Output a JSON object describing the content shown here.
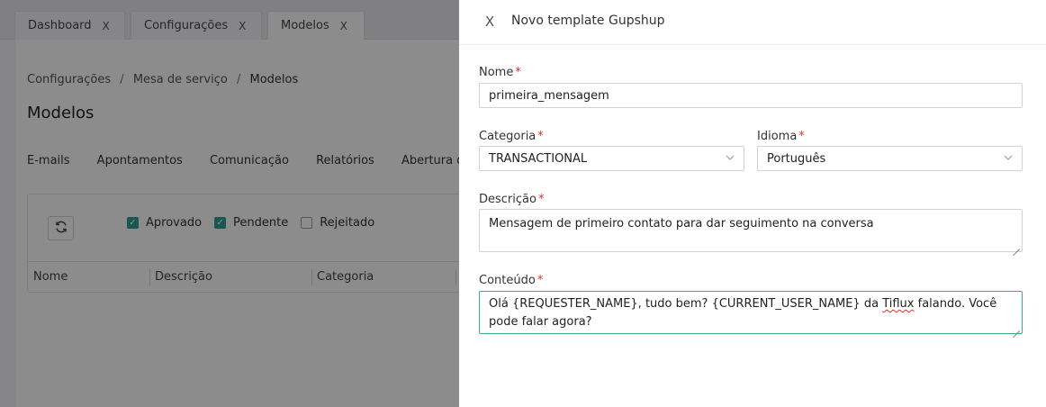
{
  "tabs": [
    {
      "label": "Dashboard",
      "close": "X"
    },
    {
      "label": "Configurações",
      "close": "X"
    },
    {
      "label": "Modelos",
      "close": "X"
    }
  ],
  "breadcrumb": {
    "items": [
      "Configurações",
      "Mesa de serviço",
      "Modelos"
    ],
    "separator": "/"
  },
  "page_title": "Modelos",
  "subtabs": [
    "E-mails",
    "Apontamentos",
    "Comunicação",
    "Relatórios",
    "Abertura de"
  ],
  "filters": [
    {
      "label": "Aprovado",
      "checked": true
    },
    {
      "label": "Pendente",
      "checked": true
    },
    {
      "label": "Rejeitado",
      "checked": false
    }
  ],
  "table": {
    "columns": [
      "Nome",
      "Descrição",
      "Categoria"
    ]
  },
  "drawer": {
    "close_icon": "X",
    "title": "Novo template Gupshup",
    "name": {
      "label": "Nome",
      "required": "*",
      "value": "primeira_mensagem"
    },
    "category": {
      "label": "Categoria",
      "required": "*",
      "value": "TRANSACTIONAL"
    },
    "language": {
      "label": "Idioma",
      "required": "*",
      "value": "Português"
    },
    "description": {
      "label": "Descrição",
      "required": "*",
      "value": "Mensagem de primeiro contato para dar seguimento na conversa"
    },
    "content": {
      "label": "Conteúdo",
      "required": "*",
      "value_part1": "Olá {REQUESTER_NAME}, tudo bem? {CURRENT_USER_NAME} da ",
      "value_misspelled": "Tiflux",
      "value_part2": " falando. Você pode falar agora?"
    }
  },
  "colors": {
    "accent": "#2f9e92",
    "required": "#d9342b",
    "focus_border": "#3aa89b"
  },
  "icons": {
    "refresh": "refresh-icon",
    "close": "close-icon",
    "chevron": "chevron-down-icon"
  }
}
